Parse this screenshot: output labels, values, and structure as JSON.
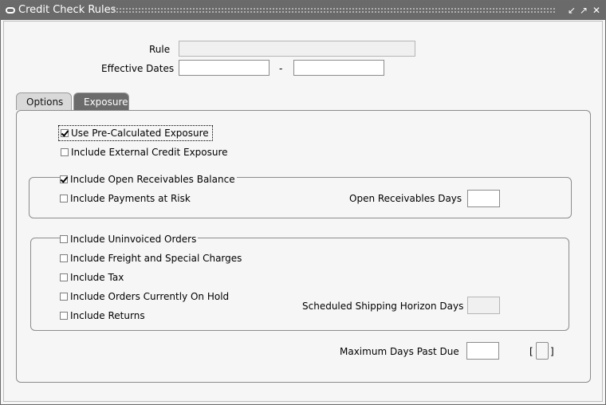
{
  "window": {
    "title": "Credit Check Rules"
  },
  "header": {
    "rule_label": "Rule",
    "rule_value": "",
    "effective_dates_label": "Effective Dates",
    "effective_from_value": "",
    "date_separator": "-",
    "effective_to_value": ""
  },
  "tabs": [
    {
      "label": "Options",
      "active": false
    },
    {
      "label": "Exposure",
      "active": true
    }
  ],
  "exposure": {
    "use_precalculated": {
      "label": "Use Pre-Calculated Exposure",
      "checked": true
    },
    "include_external": {
      "label": "Include External Credit Exposure",
      "checked": false
    },
    "open_receivables": {
      "label": "Include Open Receivables Balance",
      "checked": true,
      "payments_at_risk": {
        "label": "Include Payments at Risk",
        "checked": false
      },
      "days_label": "Open Receivables Days",
      "days_value": ""
    },
    "uninvoiced": {
      "label": "Include Uninvoiced Orders",
      "checked": false,
      "freight": {
        "label": "Include Freight and Special Charges",
        "checked": false
      },
      "tax": {
        "label": "Include Tax",
        "checked": false
      },
      "on_hold": {
        "label": "Include Orders Currently On Hold",
        "checked": false
      },
      "returns": {
        "label": "Include Returns",
        "checked": false
      },
      "shipping_horizon_label": "Scheduled Shipping Horizon Days",
      "shipping_horizon_value": ""
    },
    "max_days_past_due_label": "Maximum Days Past Due",
    "max_days_past_due_value": "",
    "descriptive_flex_open": "[",
    "descriptive_flex_close": "]"
  }
}
